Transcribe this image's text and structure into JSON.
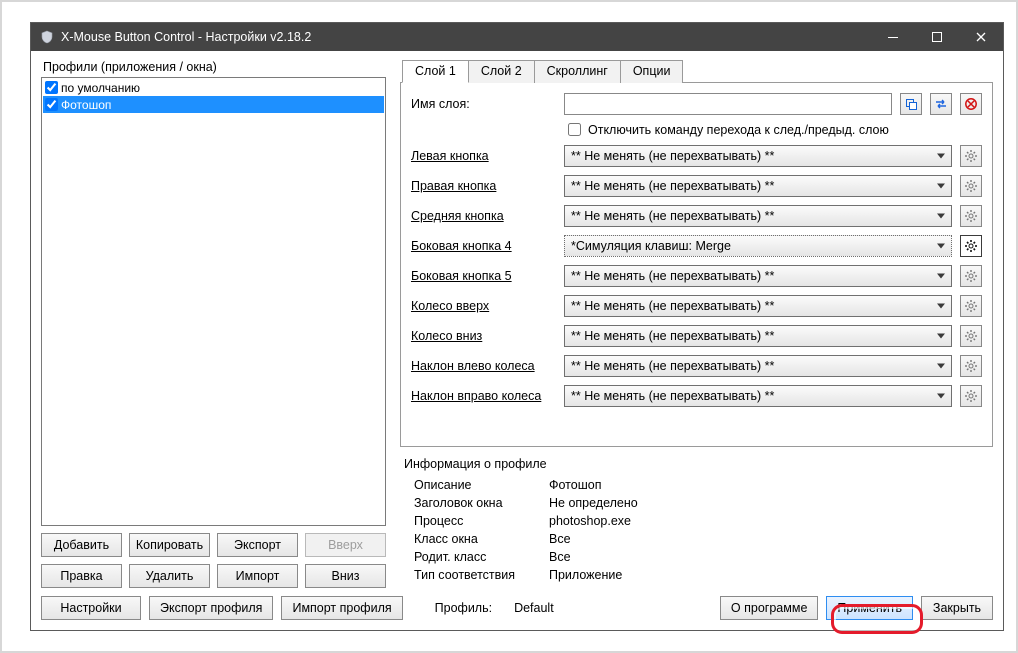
{
  "window": {
    "title": "X-Mouse Button Control - Настройки v2.18.2"
  },
  "left": {
    "header": "Профили (приложения / окна)",
    "items": [
      {
        "label": "по умолчанию",
        "checked": true,
        "selected": false
      },
      {
        "label": "Фотошоп",
        "checked": true,
        "selected": true
      }
    ],
    "btns": {
      "add": "Добавить",
      "copy": "Копировать",
      "export": "Экспорт",
      "up": "Вверх",
      "edit": "Правка",
      "delete": "Удалить",
      "import": "Импорт",
      "down": "Вниз"
    }
  },
  "right": {
    "tabs": {
      "t1": "Слой 1",
      "t2": "Слой 2",
      "t3": "Скроллинг",
      "t4": "Опции"
    },
    "name_label": "Имя слоя:",
    "disable_label": "Отключить команду перехода к след./предыд. слою",
    "default_text": "** Не менять (не перехватывать) **",
    "rows": {
      "lb": {
        "label": "Левая кнопка"
      },
      "rb": {
        "label": "Правая кнопка"
      },
      "mb": {
        "label": "Средняя кнопка"
      },
      "s4": {
        "label": "Боковая кнопка 4",
        "value": "*Симуляция клавиш: Merge"
      },
      "s5": {
        "label": "Боковая кнопка 5"
      },
      "wu": {
        "label": "Колесо вверх"
      },
      "wd": {
        "label": "Колесо вниз"
      },
      "tl": {
        "label": "Наклон влево колеса"
      },
      "tr": {
        "label": "Наклон вправо колеса"
      }
    }
  },
  "info": {
    "title": "Информация о профиле",
    "desc_k": "Описание",
    "desc_v": "Фотошоп",
    "wt_k": "Заголовок окна",
    "wt_v": "Не определено",
    "proc_k": "Процесс",
    "proc_v": "photoshop.exe",
    "cls_k": "Класс окна",
    "cls_v": "Все",
    "pcls_k": "Родит. класс",
    "pcls_v": "Все",
    "mt_k": "Тип соответствия",
    "mt_v": "Приложение"
  },
  "bottom": {
    "settings": "Настройки",
    "export": "Экспорт профиля",
    "import": "Импорт профиля",
    "profile_k": "Профиль:",
    "profile_v": "Default",
    "about": "О программе",
    "apply": "Применить",
    "close": "Закрыть"
  }
}
